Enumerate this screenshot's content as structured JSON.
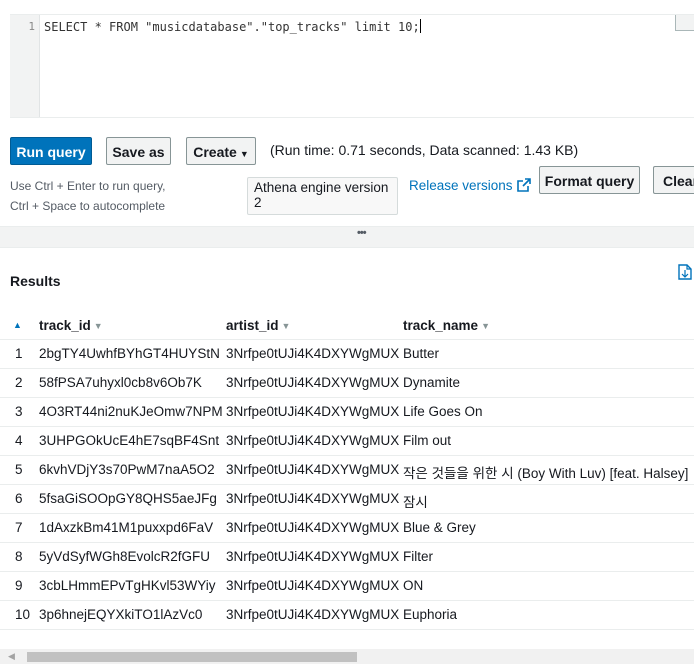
{
  "editor": {
    "line_number": "1",
    "code": "SELECT * FROM \"musicdatabase\".\"top_tracks\" limit 10;"
  },
  "toolbar": {
    "run_query": "Run query",
    "save_as": "Save as",
    "create": "Create",
    "run_info": "(Run time: 0.71 seconds, Data scanned: 1.43 KB)",
    "format_query": "Format query",
    "clear": "Clear"
  },
  "hints": {
    "line1": "Use Ctrl + Enter to run query,",
    "line2": "Ctrl + Space to autocomplete"
  },
  "engine": "Athena engine version 2",
  "release_versions": "Release versions",
  "results": {
    "title": "Results",
    "columns": [
      "track_id",
      "artist_id",
      "track_name"
    ],
    "rows": [
      {
        "n": "1",
        "track_id": "2bgTY4UwhfBYhGT4HUYStN",
        "artist_id": "3Nrfpe0tUJi4K4DXYWgMUX",
        "track_name": "Butter"
      },
      {
        "n": "2",
        "track_id": "58fPSA7uhyxl0cb8v6Ob7K",
        "artist_id": "3Nrfpe0tUJi4K4DXYWgMUX",
        "track_name": "Dynamite"
      },
      {
        "n": "3",
        "track_id": "4O3RT44ni2nuKJeOmw7NPM",
        "artist_id": "3Nrfpe0tUJi4K4DXYWgMUX",
        "track_name": "Life Goes On"
      },
      {
        "n": "4",
        "track_id": "3UHPGOkUcE4hE7sqBF4Snt",
        "artist_id": "3Nrfpe0tUJi4K4DXYWgMUX",
        "track_name": "Film out"
      },
      {
        "n": "5",
        "track_id": "6kvhVDjY3s70PwM7naA5O2",
        "artist_id": "3Nrfpe0tUJi4K4DXYWgMUX",
        "track_name": "작은 것들을 위한 시 (Boy With Luv) [feat. Halsey]"
      },
      {
        "n": "6",
        "track_id": "5fsaGiSOOpGY8QHS5aeJFg",
        "artist_id": "3Nrfpe0tUJi4K4DXYWgMUX",
        "track_name": "잠시"
      },
      {
        "n": "7",
        "track_id": "1dAxzkBm41M1puxxpd6FaV",
        "artist_id": "3Nrfpe0tUJi4K4DXYWgMUX",
        "track_name": "Blue & Grey"
      },
      {
        "n": "8",
        "track_id": "5yVdSyfWGh8EvolcR2fGFU",
        "artist_id": "3Nrfpe0tUJi4K4DXYWgMUX",
        "track_name": "Filter"
      },
      {
        "n": "9",
        "track_id": "3cbLHmmEPvTgHKvl53WYiy",
        "artist_id": "3Nrfpe0tUJi4K4DXYWgMUX",
        "track_name": "ON"
      },
      {
        "n": "10",
        "track_id": "3p6hnejEQYXkiTO1lAzVc0",
        "artist_id": "3Nrfpe0tUJi4K4DXYWgMUX",
        "track_name": "Euphoria"
      }
    ]
  },
  "icons": {
    "external_link": "external-link-icon",
    "download": "document-download-icon",
    "sort": "sort-caret-icon",
    "resize": "resize-handle-icon"
  },
  "colors": {
    "primary": "#0073bb",
    "link": "#0073bb"
  }
}
